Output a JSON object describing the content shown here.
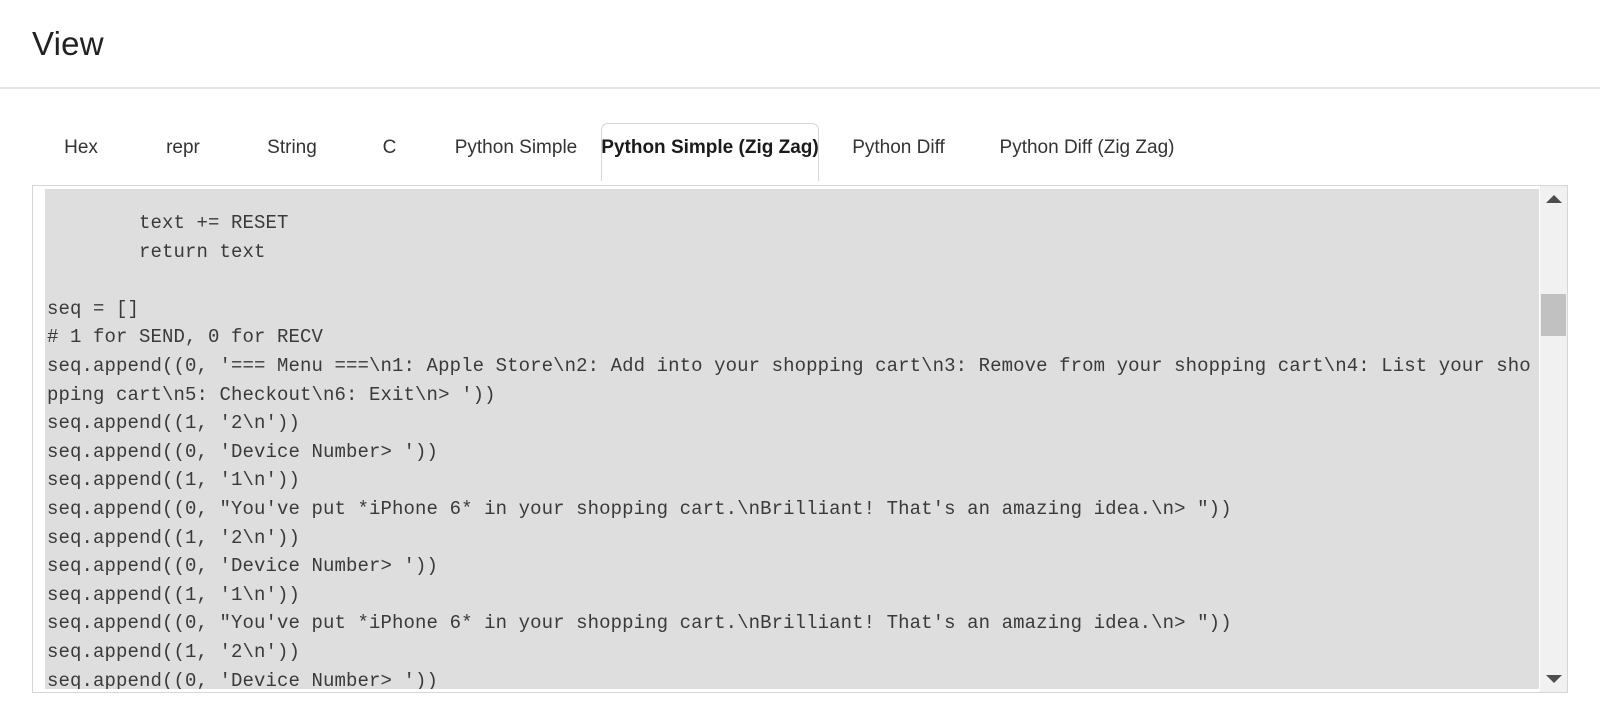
{
  "header": {
    "title": "View"
  },
  "tabs": [
    {
      "label": "Hex",
      "active": false
    },
    {
      "label": "repr",
      "active": false
    },
    {
      "label": "String",
      "active": false
    },
    {
      "label": "C",
      "active": false
    },
    {
      "label": "Python Simple",
      "active": false
    },
    {
      "label": "Python Simple (Zig Zag)",
      "active": true
    },
    {
      "label": "Python Diff",
      "active": false
    },
    {
      "label": "Python Diff (Zig Zag)",
      "active": false
    }
  ],
  "viewer": {
    "code": "        text += RESET\n        return text\n\nseq = []\n# 1 for SEND, 0 for RECV\nseq.append((0, '=== Menu ===\\n1: Apple Store\\n2: Add into your shopping cart\\n3: Remove from your shopping cart\\n4: List your shopping cart\\n5: Checkout\\n6: Exit\\n> '))\nseq.append((1, '2\\n'))\nseq.append((0, 'Device Number> '))\nseq.append((1, '1\\n'))\nseq.append((0, \"You've put *iPhone 6* in your shopping cart.\\nBrilliant! That's an amazing idea.\\n> \"))\nseq.append((1, '2\\n'))\nseq.append((0, 'Device Number> '))\nseq.append((1, '1\\n'))\nseq.append((0, \"You've put *iPhone 6* in your shopping cart.\\nBrilliant! That's an amazing idea.\\n> \"))\nseq.append((1, '2\\n'))\nseq.append((0, 'Device Number> '))",
    "scrollbar": {
      "up_arrow": "triangle-up-icon",
      "down_arrow": "triangle-down-icon",
      "thumb": "scroll-thumb"
    }
  },
  "colors": {
    "code_background": "#dedede",
    "panel_border": "#d6d6d6",
    "text": "#3a3a3a",
    "scrollbar_track": "#f1f1f1",
    "scrollbar_thumb": "#c1c1c1"
  }
}
